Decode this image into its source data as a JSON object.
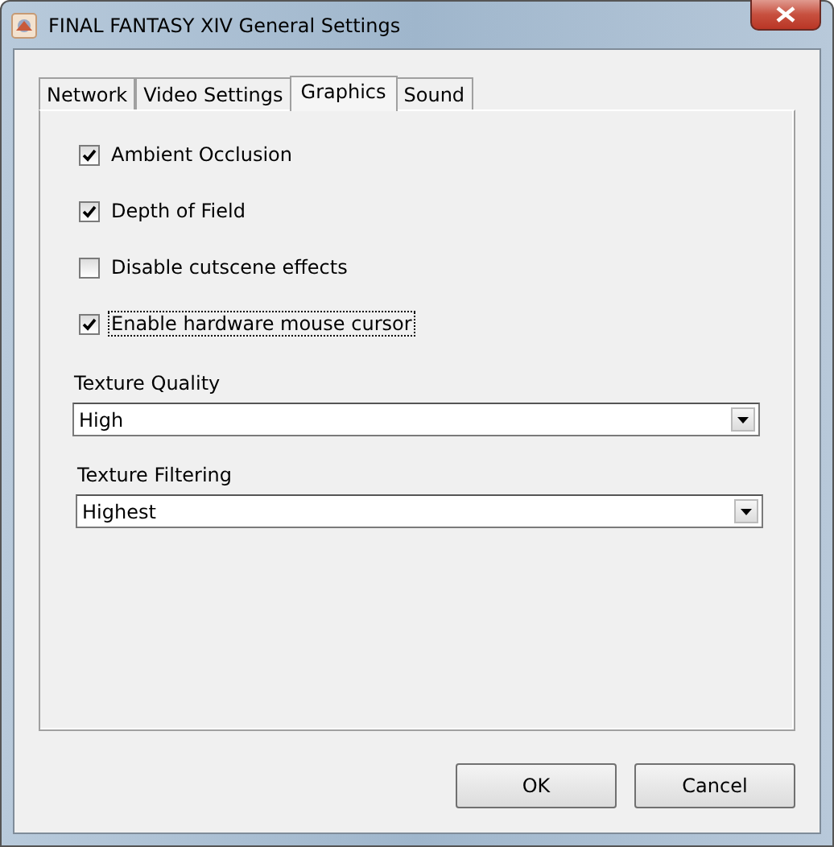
{
  "window": {
    "title": "FINAL FANTASY XIV General Settings"
  },
  "tabs": [
    {
      "label": "Network",
      "selected": false
    },
    {
      "label": "Video Settings",
      "selected": false
    },
    {
      "label": "Graphics",
      "selected": true
    },
    {
      "label": "Sound",
      "selected": false
    }
  ],
  "checkboxes": [
    {
      "label": "Ambient Occlusion",
      "checked": true,
      "focused": false
    },
    {
      "label": "Depth of Field",
      "checked": true,
      "focused": false
    },
    {
      "label": "Disable cutscene effects",
      "checked": false,
      "focused": false
    },
    {
      "label": "Enable hardware mouse cursor",
      "checked": true,
      "focused": true
    }
  ],
  "dropdowns": [
    {
      "label": "Texture Quality",
      "value": "High"
    },
    {
      "label": "Texture Filtering",
      "value": "Highest"
    }
  ],
  "buttons": [
    "OK",
    "Cancel"
  ]
}
